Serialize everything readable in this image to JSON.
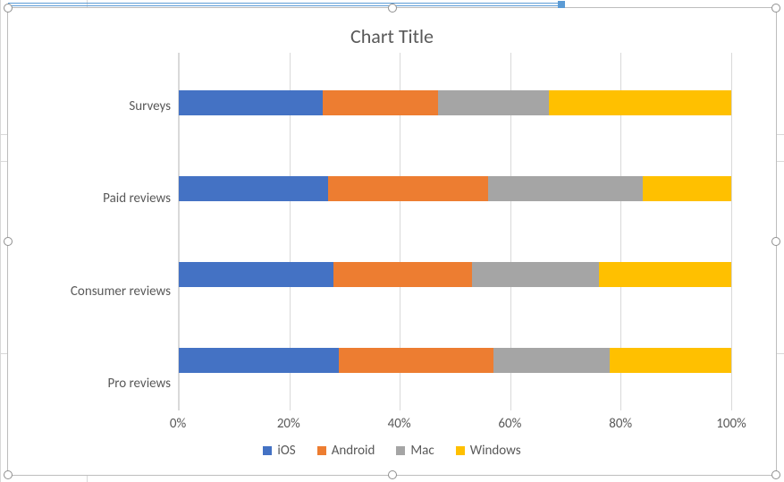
{
  "chart_data": {
    "type": "bar",
    "orientation": "horizontal",
    "stacked": "100%",
    "title": "Chart Title",
    "xlabel": "",
    "ylabel": "",
    "xlim": [
      0,
      100
    ],
    "xticks_pct": [
      0,
      20,
      40,
      60,
      80,
      100
    ],
    "xtick_labels": [
      "0%",
      "20%",
      "40%",
      "60%",
      "80%",
      "100%"
    ],
    "categories_top_to_bottom": [
      "Surveys",
      "Paid reviews",
      "Consumer reviews",
      "Pro reviews"
    ],
    "series": [
      {
        "name": "iOS",
        "color": "#4472c4",
        "values_pct_top_to_bottom": [
          26,
          27,
          28,
          29
        ]
      },
      {
        "name": "Android",
        "color": "#ed7d31",
        "values_pct_top_to_bottom": [
          21,
          29,
          25,
          28
        ]
      },
      {
        "name": "Mac",
        "color": "#a5a5a5",
        "values_pct_top_to_bottom": [
          20,
          28,
          23,
          21
        ]
      },
      {
        "name": "Windows",
        "color": "#ffc000",
        "values_pct_top_to_bottom": [
          33,
          16,
          24,
          22
        ]
      }
    ],
    "legend": [
      "iOS",
      "Android",
      "Mac",
      "Windows"
    ],
    "legend_position": "bottom",
    "grid": {
      "x": true,
      "y": false
    }
  }
}
